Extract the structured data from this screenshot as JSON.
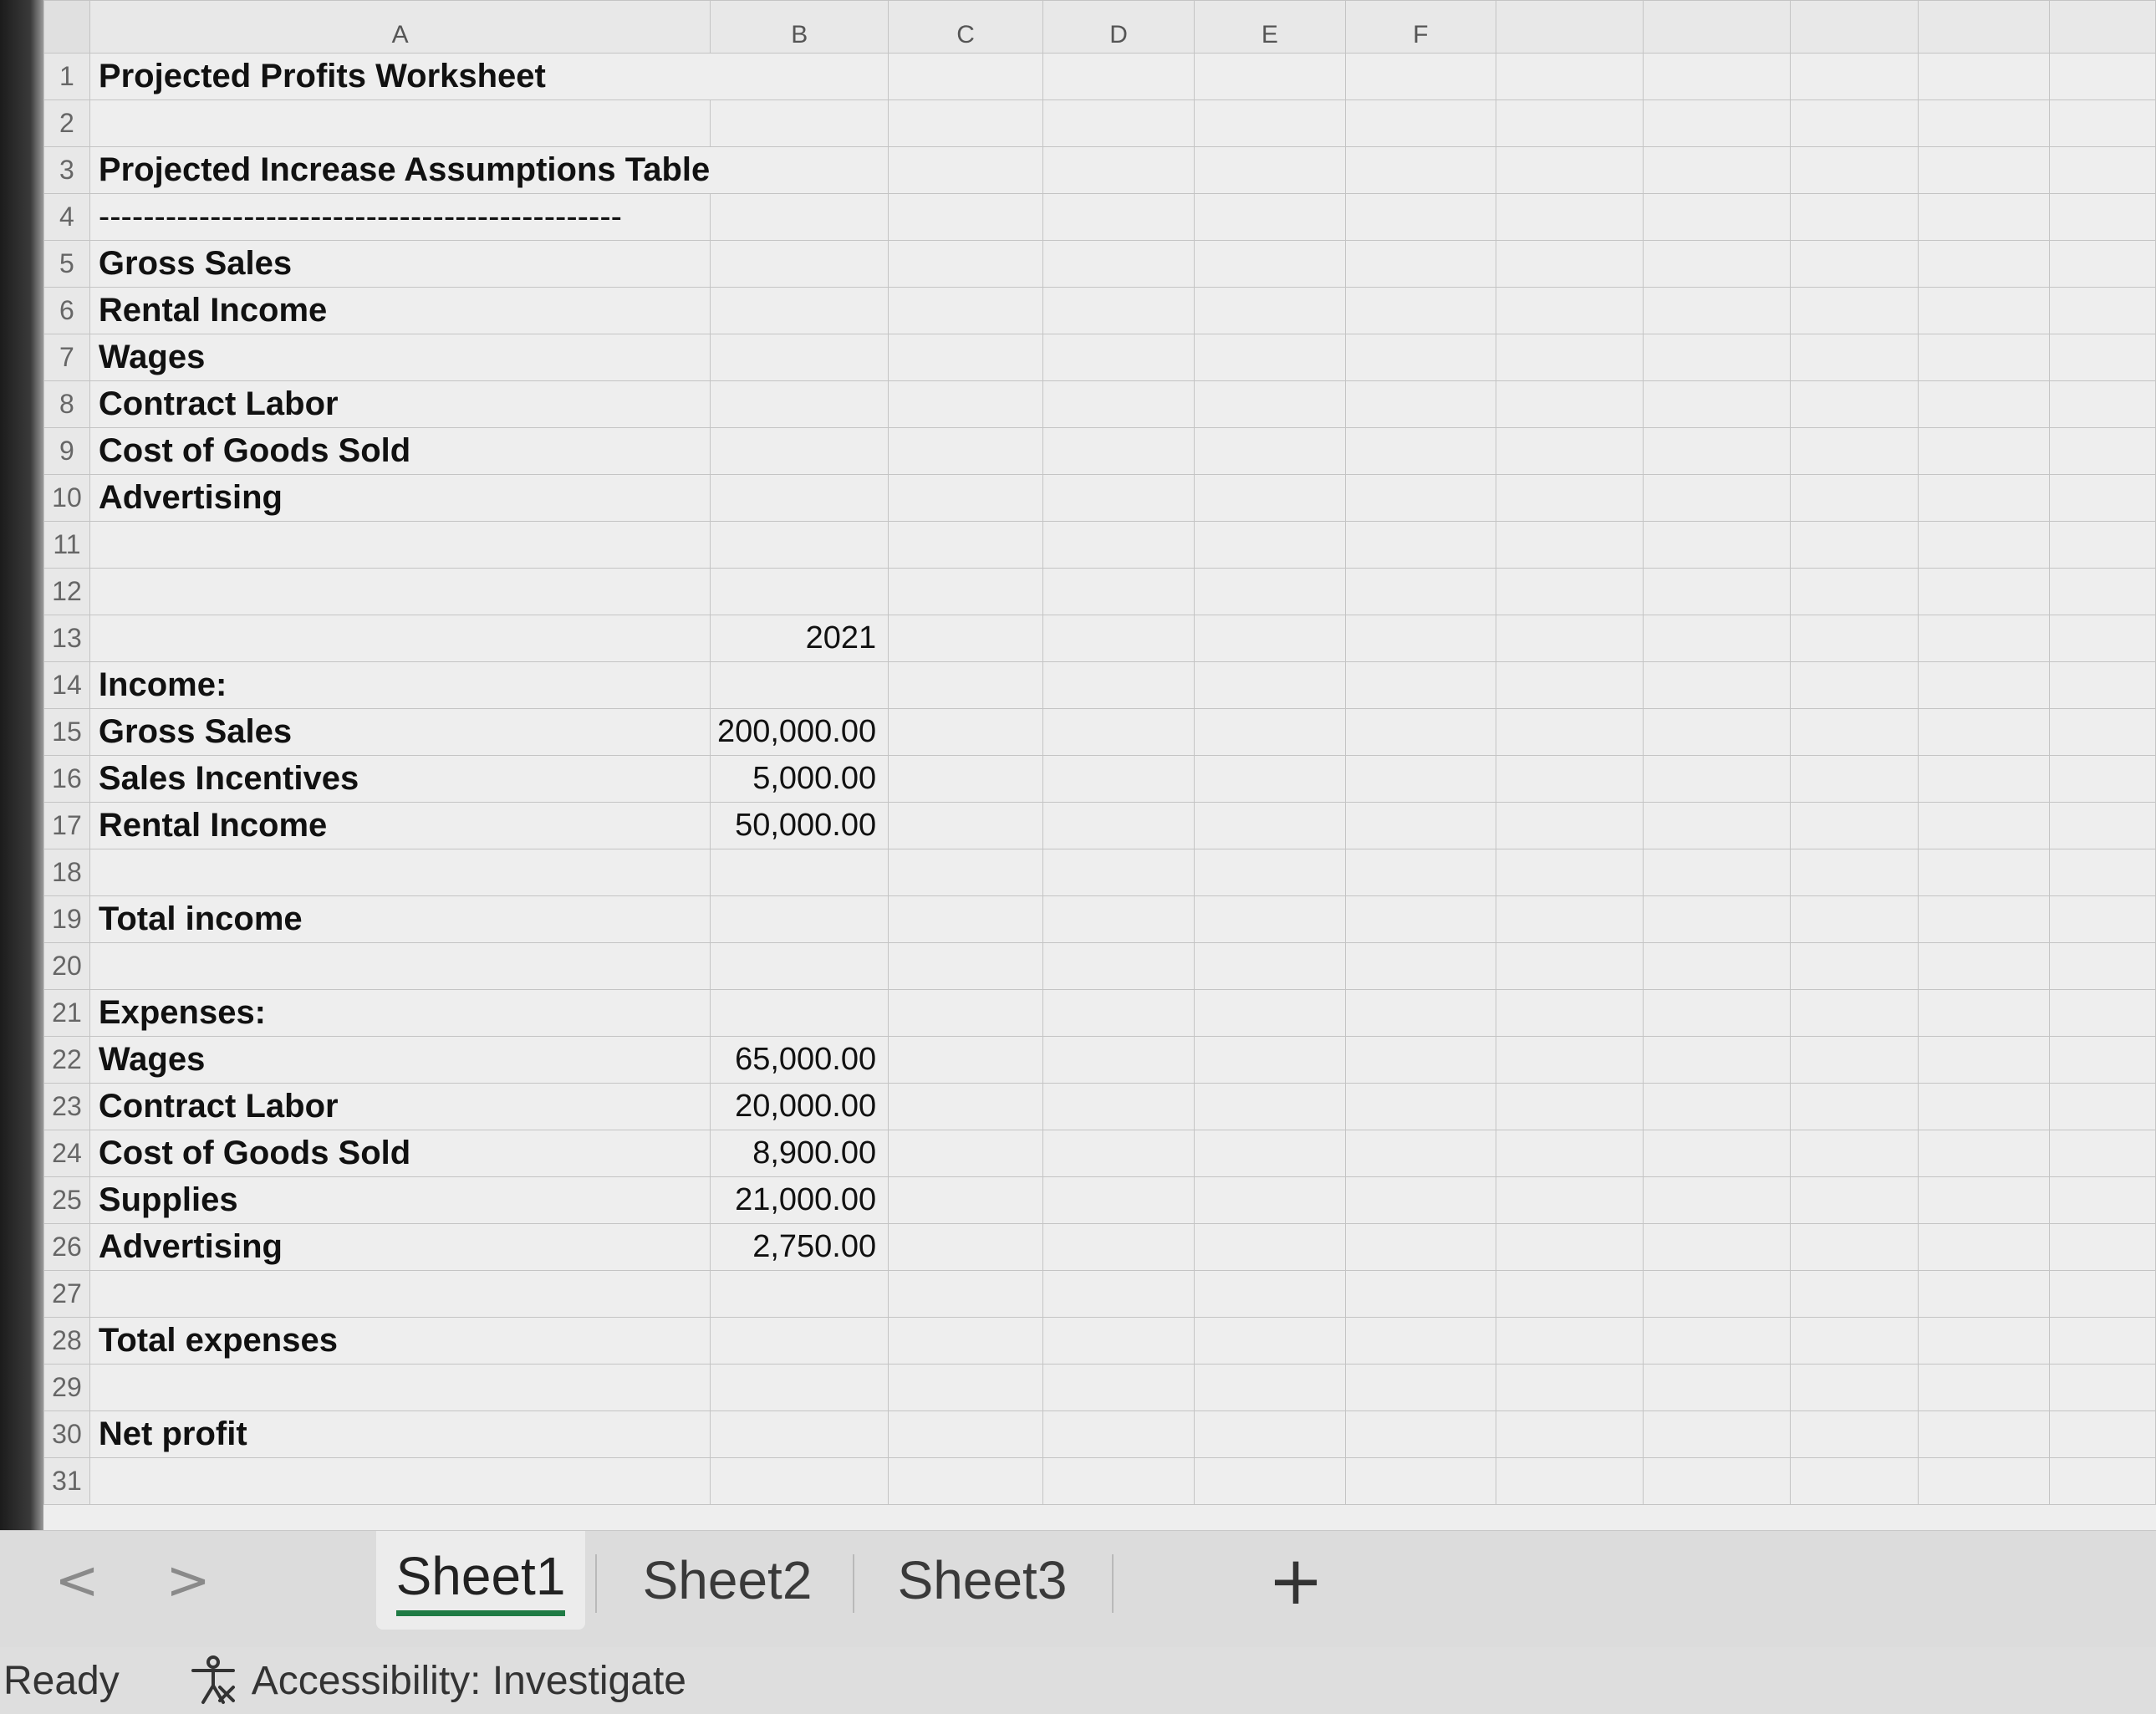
{
  "columns": [
    "A",
    "B",
    "C",
    "D",
    "E",
    "F",
    "",
    "",
    "",
    "",
    ""
  ],
  "rows": [
    {
      "num": "1",
      "a": "Projected Profits Worksheet",
      "b": ""
    },
    {
      "num": "2",
      "a": "",
      "b": ""
    },
    {
      "num": "3",
      "a": "Projected Increase Assumptions Table",
      "b": ""
    },
    {
      "num": "4",
      "a": "-----------------------------------------------",
      "b": ""
    },
    {
      "num": "5",
      "a": "Gross Sales",
      "b": ""
    },
    {
      "num": "6",
      "a": "Rental Income",
      "b": ""
    },
    {
      "num": "7",
      "a": "Wages",
      "b": ""
    },
    {
      "num": "8",
      "a": "Contract Labor",
      "b": ""
    },
    {
      "num": "9",
      "a": "Cost of Goods Sold",
      "b": ""
    },
    {
      "num": "10",
      "a": "Advertising",
      "b": ""
    },
    {
      "num": "11",
      "a": "",
      "b": ""
    },
    {
      "num": "12",
      "a": "",
      "b": ""
    },
    {
      "num": "13",
      "a": "",
      "b": "2021"
    },
    {
      "num": "14",
      "a": "Income:",
      "b": ""
    },
    {
      "num": "15",
      "a": "Gross Sales",
      "b": "200,000.00"
    },
    {
      "num": "16",
      "a": "Sales Incentives",
      "b": "5,000.00"
    },
    {
      "num": "17",
      "a": "Rental Income",
      "b": "50,000.00"
    },
    {
      "num": "18",
      "a": "",
      "b": ""
    },
    {
      "num": "19",
      "a": "Total income",
      "b": ""
    },
    {
      "num": "20",
      "a": "",
      "b": ""
    },
    {
      "num": "21",
      "a": "Expenses:",
      "b": ""
    },
    {
      "num": "22",
      "a": "Wages",
      "b": "65,000.00"
    },
    {
      "num": "23",
      "a": "Contract Labor",
      "b": "20,000.00"
    },
    {
      "num": "24",
      "a": "Cost of Goods Sold",
      "b": "8,900.00"
    },
    {
      "num": "25",
      "a": "Supplies",
      "b": "21,000.00"
    },
    {
      "num": "26",
      "a": "Advertising",
      "b": "2,750.00"
    },
    {
      "num": "27",
      "a": "",
      "b": ""
    },
    {
      "num": "28",
      "a": "Total expenses",
      "b": ""
    },
    {
      "num": "29",
      "a": "",
      "b": ""
    },
    {
      "num": "30",
      "a": "Net profit",
      "b": ""
    },
    {
      "num": "31",
      "a": "",
      "b": ""
    }
  ],
  "tabs": {
    "prev_arrow": "<",
    "next_arrow": ">",
    "sheet1": "Sheet1",
    "sheet2": "Sheet2",
    "sheet3": "Sheet3",
    "add": "+"
  },
  "status": {
    "ready": "Ready",
    "accessibility": "Accessibility: Investigate"
  },
  "colors": {
    "active_tab_underline": "#1e7a44",
    "grid_background": "#eeeeee",
    "grid_lines": "#c4c4c4"
  },
  "icons": {
    "accessibility": "accessibility-person-icon"
  }
}
